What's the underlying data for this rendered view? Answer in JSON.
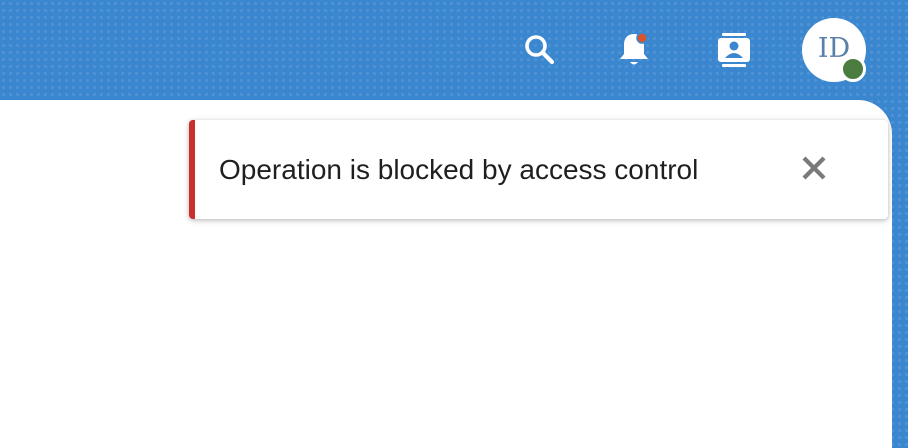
{
  "header": {
    "icons": {
      "search": "search-icon",
      "notifications": "bell-icon",
      "contacts": "contact-card-icon"
    },
    "notification_dot_color": "#d9532c",
    "avatar": {
      "initials": "ID",
      "presence_color": "#4a7d3f"
    },
    "background_color": "#3a86cf"
  },
  "toast": {
    "message": "Operation is blocked by access control",
    "severity_color": "#c8302c",
    "close_icon": "close-icon"
  }
}
